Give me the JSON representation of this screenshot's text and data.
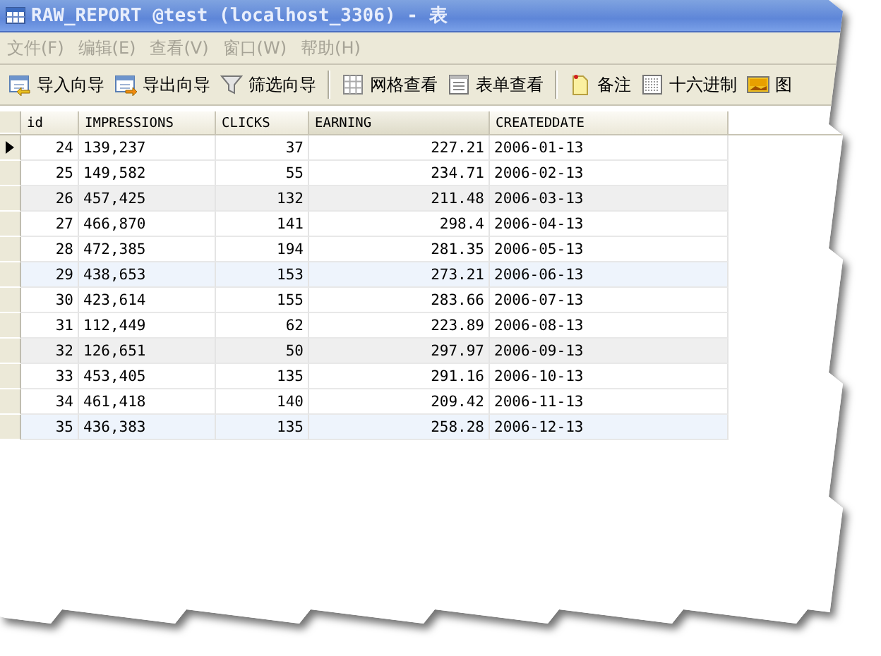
{
  "window": {
    "title": "RAW_REPORT @test (localhost_3306) - 表"
  },
  "menu": [
    {
      "label": "文件(F)",
      "disabled": true
    },
    {
      "label": "编辑(E)",
      "disabled": true
    },
    {
      "label": "查看(V)",
      "disabled": true
    },
    {
      "label": "窗口(W)",
      "disabled": true
    },
    {
      "label": "帮助(H)",
      "disabled": true
    }
  ],
  "toolbar": [
    {
      "kind": "import",
      "label": "导入向导"
    },
    {
      "kind": "export",
      "label": "导出向导"
    },
    {
      "kind": "filter",
      "label": "筛选向导"
    },
    {
      "kind": "separator"
    },
    {
      "kind": "grid",
      "label": "网格查看"
    },
    {
      "kind": "form",
      "label": "表单查看"
    },
    {
      "kind": "separator"
    },
    {
      "kind": "memo",
      "label": "备注"
    },
    {
      "kind": "hex",
      "label": "十六进制"
    },
    {
      "kind": "image",
      "label": "图"
    }
  ],
  "table": {
    "columns": [
      {
        "label": "id",
        "kind": "number"
      },
      {
        "label": "IMPRESSIONS",
        "kind": "text"
      },
      {
        "label": "CLICKS",
        "kind": "number"
      },
      {
        "label": "EARNING",
        "kind": "number"
      },
      {
        "label": "CREATEDDATE",
        "kind": "text"
      }
    ],
    "rows": [
      {
        "current": true,
        "color": "#ffffff",
        "cells": [
          "24",
          "139,237",
          "37",
          "227.21",
          "2006-01-13"
        ]
      },
      {
        "current": false,
        "color": "#ffffff",
        "cells": [
          "25",
          "149,582",
          "55",
          "234.71",
          "2006-02-13"
        ]
      },
      {
        "current": false,
        "color": "#efefef",
        "cells": [
          "26",
          "457,425",
          "132",
          "211.48",
          "2006-03-13"
        ]
      },
      {
        "current": false,
        "color": "#ffffff",
        "cells": [
          "27",
          "466,870",
          "141",
          "298.4",
          "2006-04-13"
        ]
      },
      {
        "current": false,
        "color": "#ffffff",
        "cells": [
          "28",
          "472,385",
          "194",
          "281.35",
          "2006-05-13"
        ]
      },
      {
        "current": false,
        "color": "#eef4fc",
        "cells": [
          "29",
          "438,653",
          "153",
          "273.21",
          "2006-06-13"
        ]
      },
      {
        "current": false,
        "color": "#ffffff",
        "cells": [
          "30",
          "423,614",
          "155",
          "283.66",
          "2006-07-13"
        ]
      },
      {
        "current": false,
        "color": "#ffffff",
        "cells": [
          "31",
          "112,449",
          "62",
          "223.89",
          "2006-08-13"
        ]
      },
      {
        "current": false,
        "color": "#efefef",
        "cells": [
          "32",
          "126,651",
          "50",
          "297.97",
          "2006-09-13"
        ]
      },
      {
        "current": false,
        "color": "#ffffff",
        "cells": [
          "33",
          "453,405",
          "135",
          "291.16",
          "2006-10-13"
        ]
      },
      {
        "current": false,
        "color": "#ffffff",
        "cells": [
          "34",
          "461,418",
          "140",
          "209.42",
          "2006-11-13"
        ]
      },
      {
        "current": false,
        "color": "#eef4fc",
        "cells": [
          "35",
          "436,383",
          "135",
          "258.28",
          "2006-12-13"
        ]
      }
    ]
  }
}
